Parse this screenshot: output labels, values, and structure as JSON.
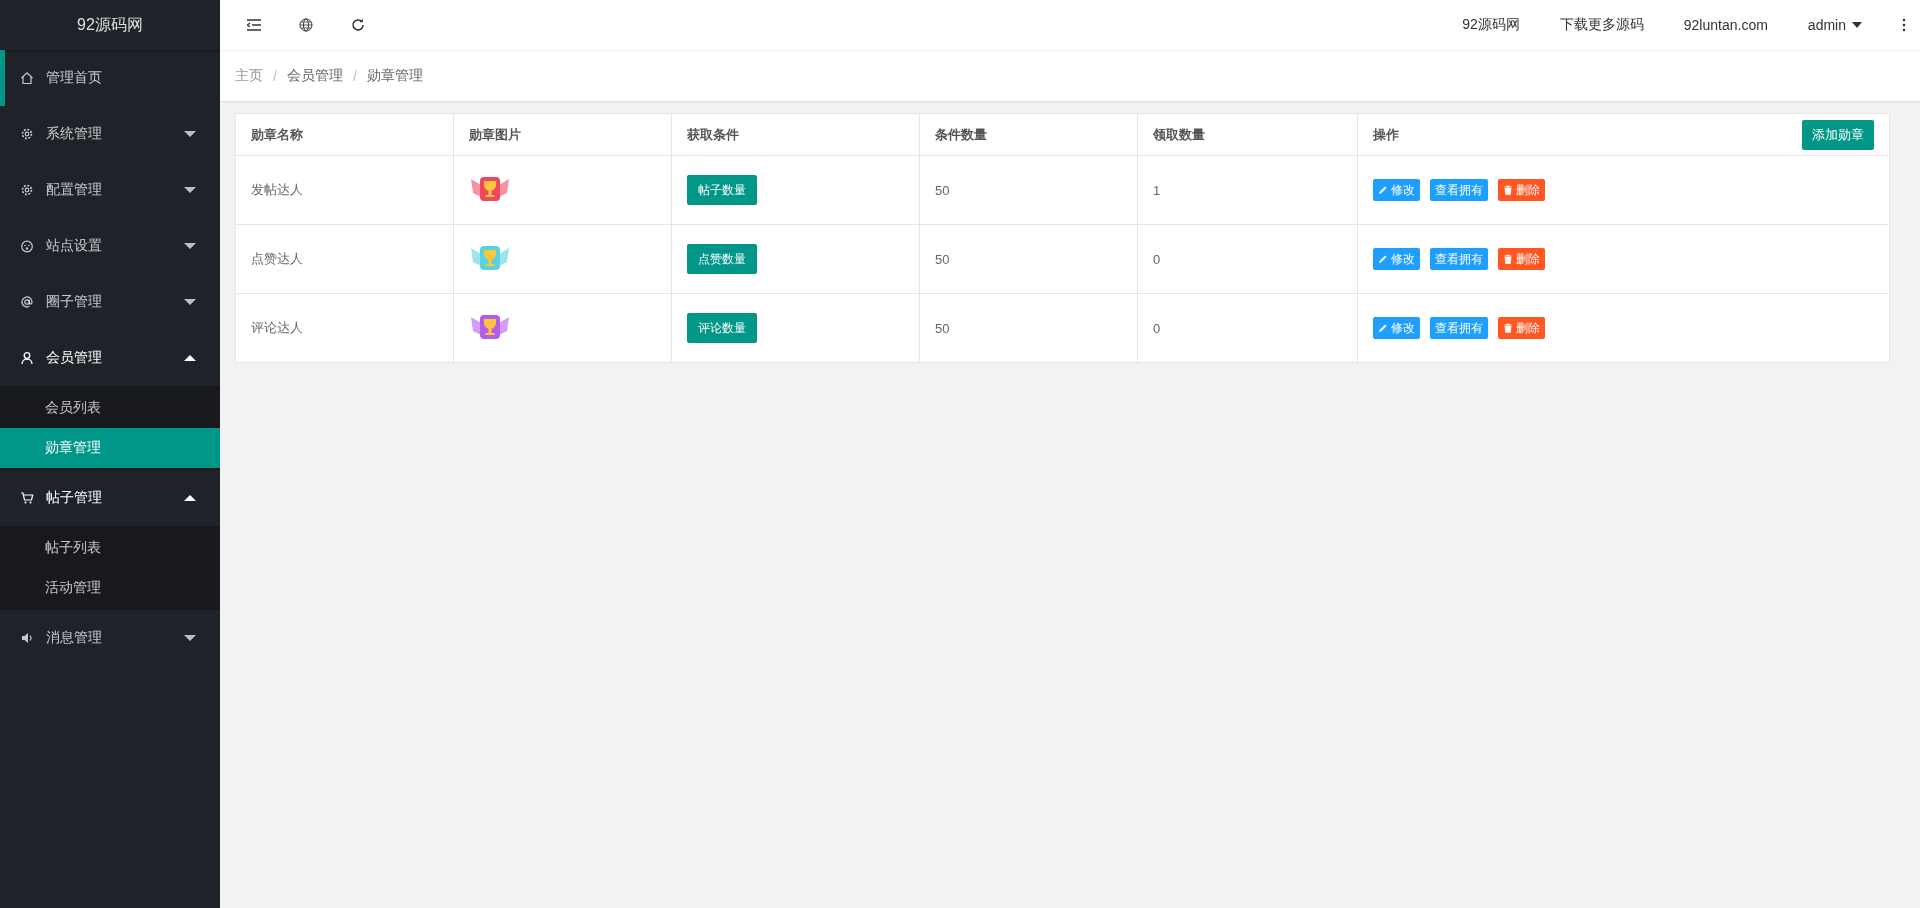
{
  "sidebar": {
    "logo": "92源码网",
    "items": [
      {
        "label": "管理首页",
        "selected": true,
        "expanded": false,
        "has_caret": false
      },
      {
        "label": "系统管理",
        "selected": false,
        "expanded": false,
        "has_caret": true
      },
      {
        "label": "配置管理",
        "selected": false,
        "expanded": false,
        "has_caret": true
      },
      {
        "label": "站点设置",
        "selected": false,
        "expanded": false,
        "has_caret": true
      },
      {
        "label": "圈子管理",
        "selected": false,
        "expanded": false,
        "has_caret": true
      },
      {
        "label": "会员管理",
        "selected": false,
        "expanded": true,
        "has_caret": true,
        "children": [
          {
            "label": "会员列表",
            "selected": false
          },
          {
            "label": "勋章管理",
            "selected": true
          }
        ]
      },
      {
        "label": "帖子管理",
        "selected": false,
        "expanded": true,
        "has_caret": true,
        "children": [
          {
            "label": "帖子列表",
            "selected": false
          },
          {
            "label": "活动管理",
            "selected": false
          }
        ]
      },
      {
        "label": "消息管理",
        "selected": false,
        "expanded": false,
        "has_caret": true
      }
    ]
  },
  "topbar": {
    "links": [
      "92源码网",
      "下载更多源码",
      "92luntan.com"
    ],
    "user": "admin"
  },
  "breadcrumb": {
    "separator": "/",
    "items": [
      "主页",
      "会员管理",
      "勋章管理"
    ]
  },
  "table": {
    "columns": [
      "勋章名称",
      "勋章图片",
      "获取条件",
      "条件数量",
      "领取数量",
      "操作"
    ],
    "add_button": "添加勋章",
    "rows": [
      {
        "name": "发帖达人",
        "color": "#f0475f",
        "condition": "帖子数量",
        "condition_count": "50",
        "claimed": "1",
        "actions": [
          "修改",
          "查看拥有",
          "删除"
        ]
      },
      {
        "name": "点赞达人",
        "color": "#5ad1e0",
        "condition": "点赞数量",
        "condition_count": "50",
        "claimed": "0",
        "actions": [
          "修改",
          "查看拥有",
          "删除"
        ]
      },
      {
        "name": "评论达人",
        "color": "#b35cf0",
        "condition": "评论数量",
        "condition_count": "50",
        "claimed": "0",
        "actions": [
          "修改",
          "查看拥有",
          "删除"
        ]
      }
    ]
  }
}
